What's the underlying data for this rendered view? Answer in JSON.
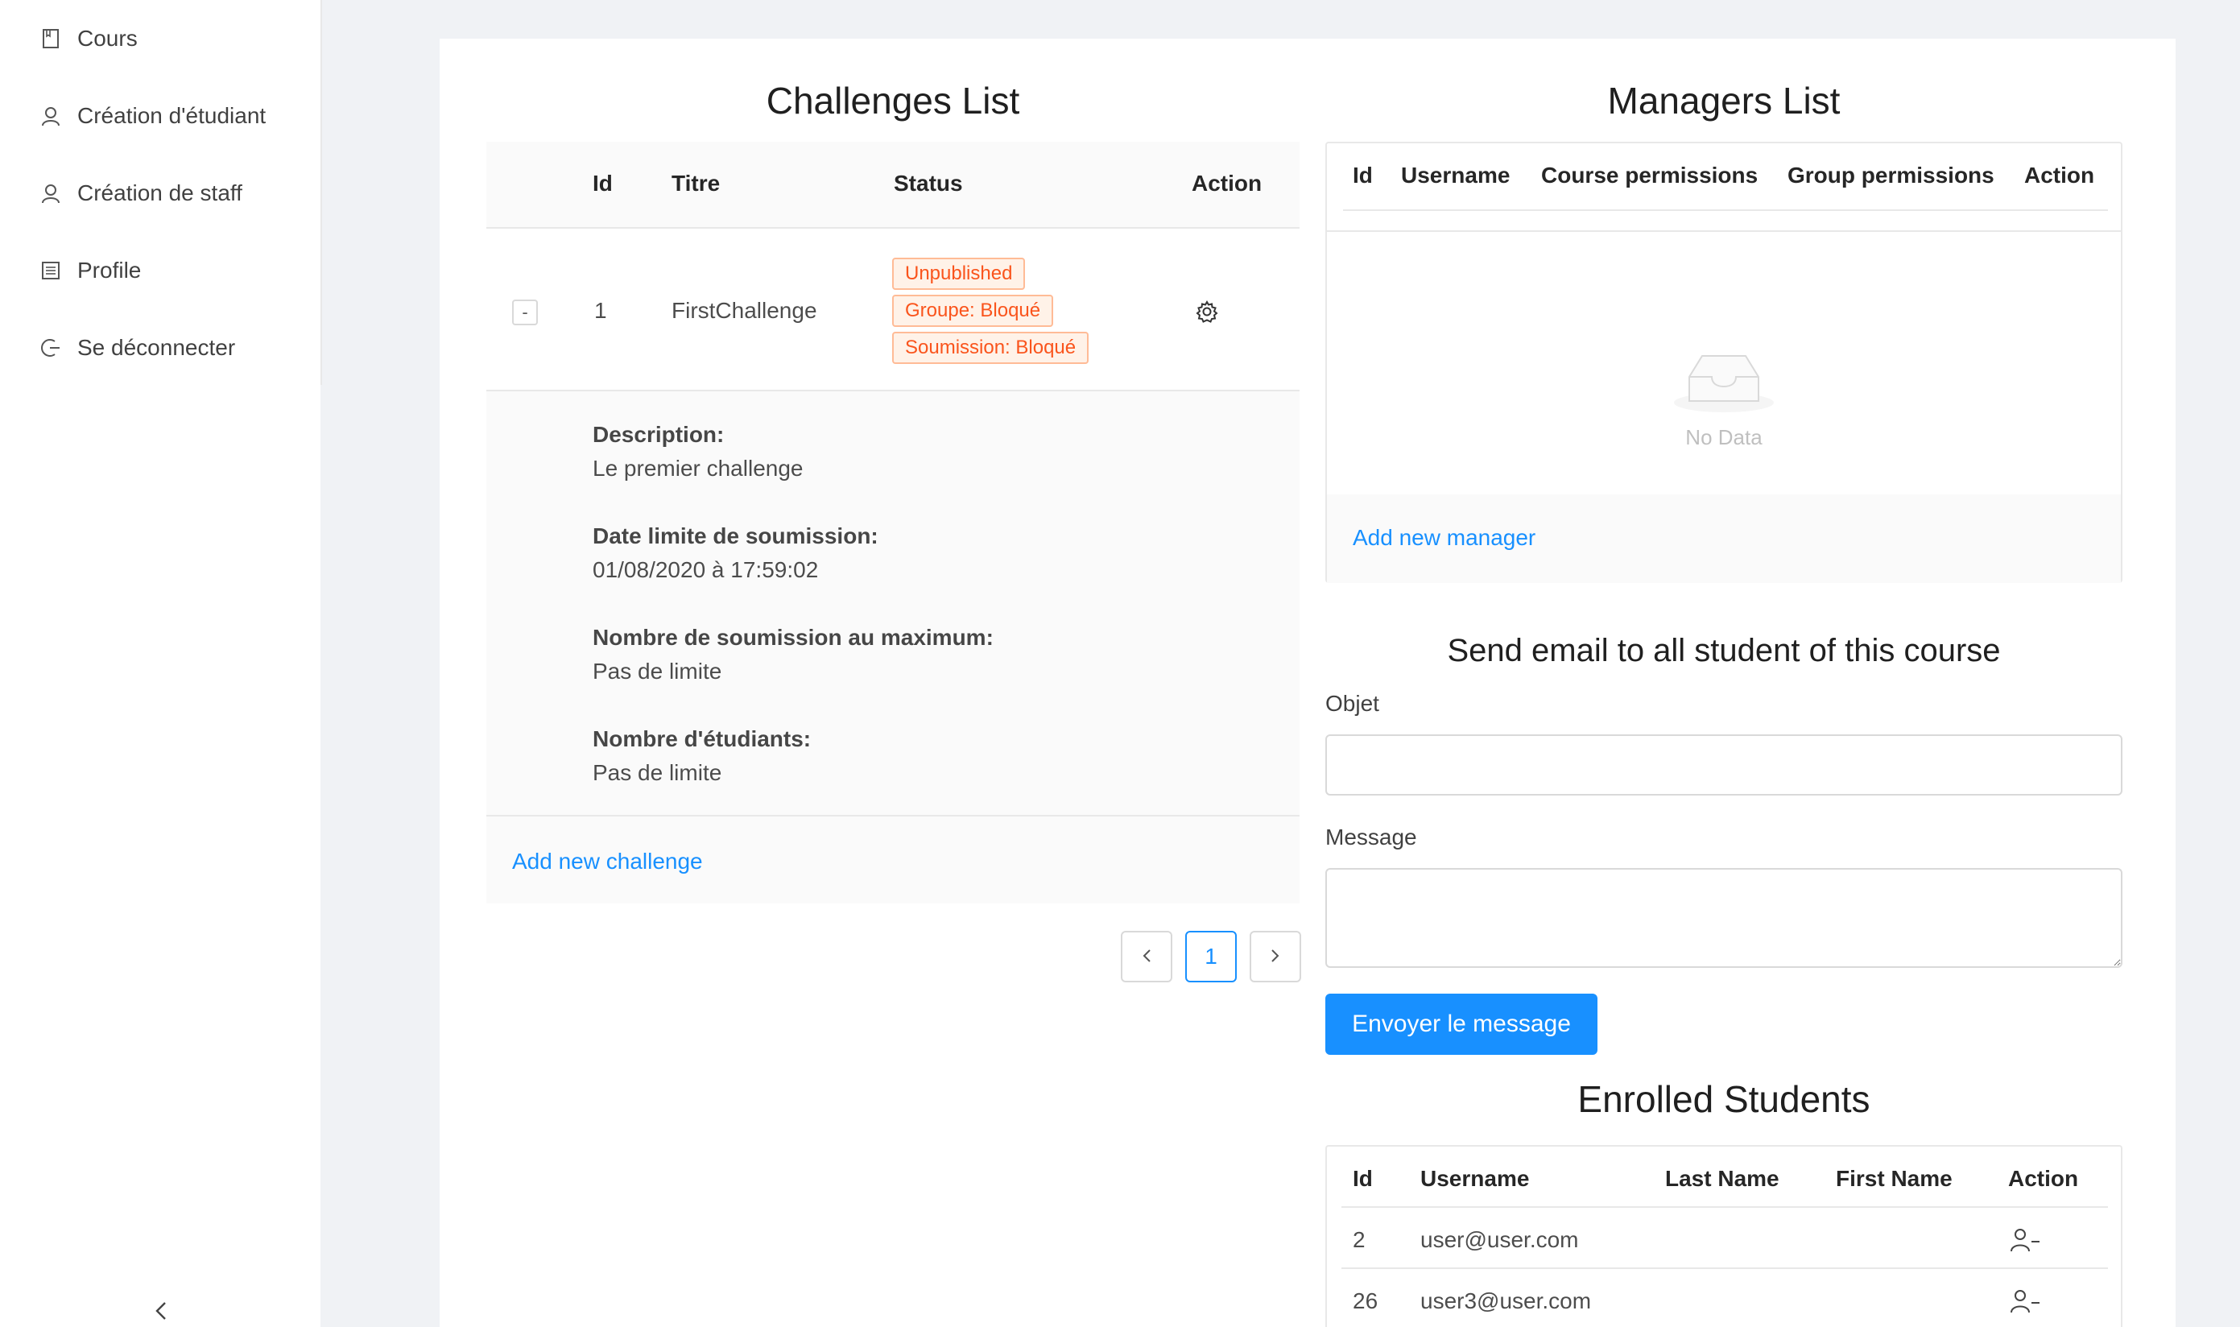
{
  "sidebar": {
    "items": [
      {
        "label": "Cours",
        "icon": "book-icon"
      },
      {
        "label": "Création d'étudiant",
        "icon": "user-icon"
      },
      {
        "label": "Création de staff",
        "icon": "user-icon"
      },
      {
        "label": "Profile",
        "icon": "profile-icon"
      },
      {
        "label": "Se déconnecter",
        "icon": "logout-icon"
      }
    ],
    "collapse_icon": "chevron-left-icon"
  },
  "challenges": {
    "title": "Challenges List",
    "columns": [
      "Id",
      "Titre",
      "Status",
      "Action"
    ],
    "rows": [
      {
        "id": "1",
        "expand_symbol": "-",
        "title": "FirstChallenge",
        "tags": [
          "Unpublished",
          "Groupe: Bloqué",
          "Soumission: Bloqué"
        ],
        "action_icon": "gear-icon",
        "details": [
          {
            "label": "Description:",
            "value": "Le premier challenge"
          },
          {
            "label": "Date limite de soumission:",
            "value": "01/08/2020 à 17:59:02"
          },
          {
            "label": "Nombre de soumission au maximum:",
            "value": "Pas de limite"
          },
          {
            "label": "Nombre d'étudiants:",
            "value": "Pas de limite"
          }
        ]
      }
    ],
    "add_link": "Add new challenge",
    "pagination": {
      "prev": "<",
      "current": "1",
      "next": ">"
    }
  },
  "managers": {
    "title": "Managers List",
    "columns": [
      "Id",
      "Username",
      "Course permissions",
      "Group permissions",
      "Action"
    ],
    "empty_text": "No Data",
    "empty_icon": "inbox-icon",
    "add_link": "Add new manager"
  },
  "email": {
    "title": "Send email to all student of this course",
    "subject_label": "Objet",
    "subject_value": "",
    "message_label": "Message",
    "message_value": "",
    "submit_label": "Envoyer le message"
  },
  "students": {
    "title": "Enrolled Students",
    "columns": [
      "Id",
      "Username",
      "Last Name",
      "First Name",
      "Action"
    ],
    "rows": [
      {
        "id": "2",
        "username": "user@user.com",
        "last_name": "",
        "first_name": "",
        "action_icon": "user-delete-icon"
      },
      {
        "id": "26",
        "username": "user3@user.com",
        "last_name": "",
        "first_name": "",
        "action_icon": "user-delete-icon"
      }
    ]
  },
  "colors": {
    "primary": "#1890ff",
    "tag_text": "#fa541c",
    "tag_bg": "#fff2e8",
    "tag_border": "#ffbb96",
    "background": "#f0f2f5"
  }
}
